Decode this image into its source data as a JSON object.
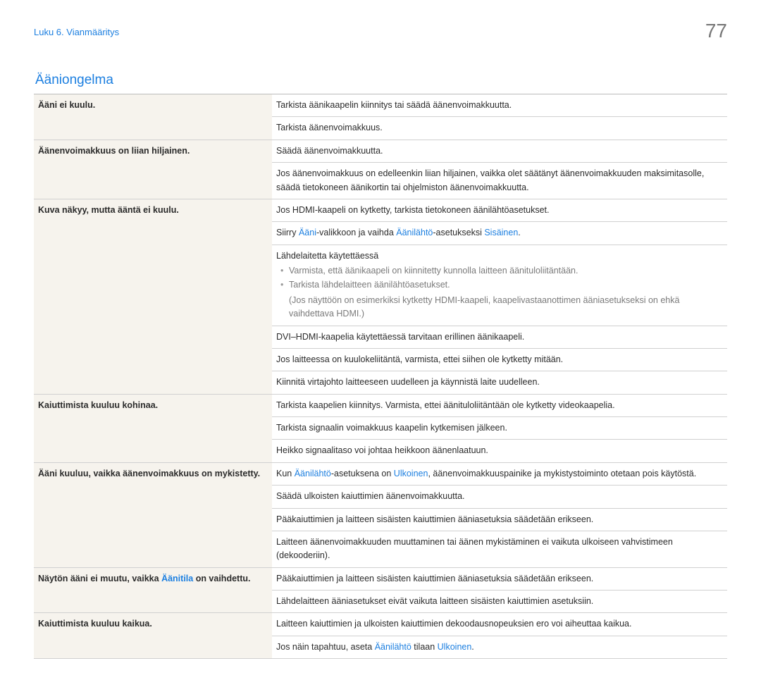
{
  "pageNumber": "77",
  "chapter": "Luku 6. Vianmääritys",
  "sectionTitle": "Ääniongelma",
  "rows": {
    "r0_issue": "Ääni ei kuulu.",
    "r0_sol": "Tarkista äänikaapelin kiinnitys tai säädä äänenvoimakkuutta.",
    "r1_sol": "Tarkista äänenvoimakkuus.",
    "r2_issue": "Äänenvoimakkuus on liian hiljainen.",
    "r2_sol": "Säädä äänenvoimakkuutta.",
    "r3_sol": "Jos äänenvoimakkuus on edelleenkin liian hiljainen, vaikka olet säätänyt äänenvoimakkuuden maksimitasolle, säädä tietokoneen äänikortin tai ohjelmiston äänenvoimakkuutta.",
    "r4_issue": "Kuva näkyy, mutta ääntä ei kuulu.",
    "r4_sol": "Jos HDMI-kaapeli on kytketty, tarkista tietokoneen äänilähtöasetukset.",
    "r5_pre": "Siirry ",
    "r5_m1": "Ääni",
    "r5_mid": "-valikkoon ja vaihda ",
    "r5_m2": "Äänilähtö",
    "r5_post1": "-asetukseksi ",
    "r5_m3": "Sisäinen",
    "r5_post2": ".",
    "r6_label": "Lähdelaitetta käytettäessä",
    "r6_b1": "Varmista, että äänikaapeli on kiinnitetty kunnolla laitteen äänituloliitäntään.",
    "r6_b2": "Tarkista lähdelaitteen äänilähtöasetukset.",
    "r6_paren": "(Jos näyttöön on esimerkiksi kytketty HDMI-kaapeli, kaapelivastaanottimen ääniasetukseksi on ehkä vaihdettava HDMI.)",
    "r7_sol": "DVI–HDMI-kaapelia käytettäessä tarvitaan erillinen äänikaapeli.",
    "r8_sol": "Jos laitteessa on kuulokeliitäntä, varmista, ettei siihen ole kytketty mitään.",
    "r9_sol": "Kiinnitä virtajohto laitteeseen uudelleen ja käynnistä laite uudelleen.",
    "r10_issue": "Kaiuttimista kuuluu kohinaa.",
    "r10_sol": "Tarkista kaapelien kiinnitys. Varmista, ettei äänituloliitäntään ole kytketty videokaapelia.",
    "r11_sol": "Tarkista signaalin voimakkuus kaapelin kytkemisen jälkeen.",
    "r12_sol": "Heikko signaalitaso voi johtaa heikkoon äänenlaatuun.",
    "r13_issue": "Ääni kuuluu, vaikka äänenvoimakkuus on mykistetty.",
    "r13_pre": "Kun ",
    "r13_m1": "Äänilähtö",
    "r13_mid": "-asetuksena on ",
    "r13_m2": "Ulkoinen",
    "r13_post": ", äänenvoimakkuuspainike ja mykistystoiminto otetaan pois käytöstä.",
    "r14_sol": "Säädä ulkoisten kaiuttimien äänenvoimakkuutta.",
    "r15_sol": "Pääkaiuttimien ja laitteen sisäisten kaiuttimien ääniasetuksia säädetään erikseen.",
    "r16_sol": "Laitteen äänenvoimakkuuden muuttaminen tai äänen mykistäminen ei vaikuta ulkoiseen vahvistimeen (dekooderiin).",
    "r17_issue_pre": "Näytön ääni ei muutu, vaikka ",
    "r17_issue_m": "Äänitila",
    "r17_issue_post": " on vaihdettu.",
    "r17_sol": "Pääkaiuttimien ja laitteen sisäisten kaiuttimien ääniasetuksia säädetään erikseen.",
    "r18_sol": "Lähdelaitteen ääniasetukset eivät vaikuta laitteen sisäisten kaiuttimien asetuksiin.",
    "r19_issue": "Kaiuttimista kuuluu kaikua.",
    "r19_sol": "Laitteen kaiuttimien ja ulkoisten kaiuttimien dekoodausnopeuksien ero voi aiheuttaa kaikua.",
    "r20_pre": "Jos näin tapahtuu, aseta ",
    "r20_m1": "Äänilähtö",
    "r20_mid": " tilaan ",
    "r20_m2": "Ulkoinen",
    "r20_post": "."
  }
}
